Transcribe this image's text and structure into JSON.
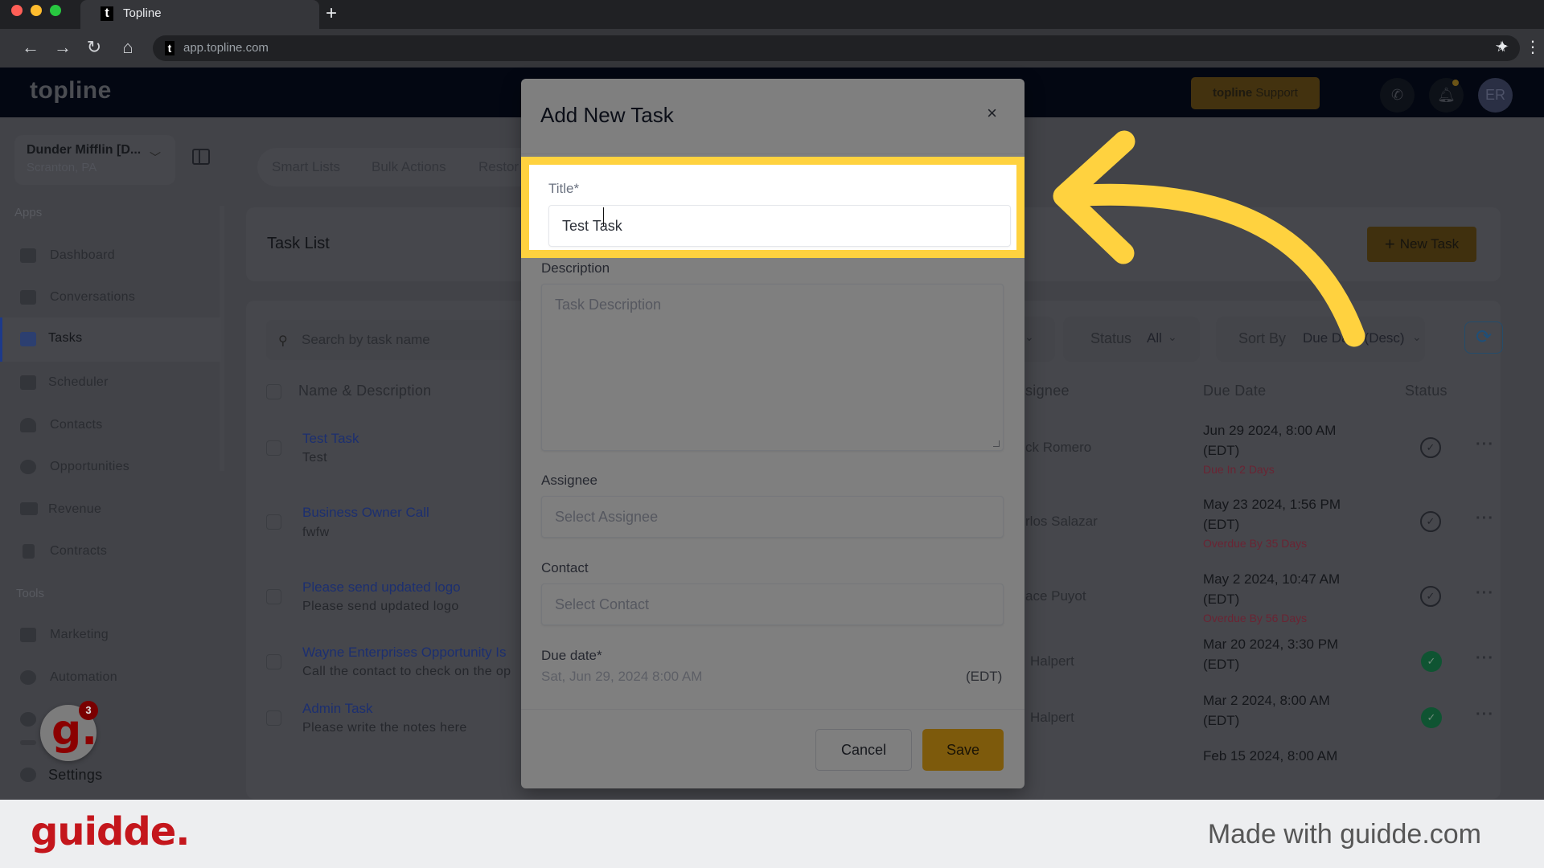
{
  "browser": {
    "tab_title": "Topline",
    "favicon_letter": "t",
    "new_tab_symbol": "+",
    "url": "app.topline.com",
    "icons": [
      "back-icon",
      "forward-icon",
      "reload-icon",
      "home-icon",
      "star-icon",
      "extensions-icon",
      "menu-icon"
    ]
  },
  "header": {
    "logo": "topline",
    "support_button_bold": "topline",
    "support_button_rest": "Support",
    "avatar_initials": "ER",
    "icons": [
      "phone-icon",
      "bell-icon"
    ]
  },
  "sidebar": {
    "location_name": "Dunder Mifflin [D...",
    "location_sub": "Scranton, PA",
    "sections": {
      "apps": "Apps",
      "tools": "Tools"
    },
    "apps_items": [
      {
        "label": "Dashboard",
        "icon": "dashboard-icon"
      },
      {
        "label": "Conversations",
        "icon": "chat-icon"
      },
      {
        "label": "Tasks",
        "icon": "task-icon",
        "active": true
      },
      {
        "label": "Scheduler",
        "icon": "calendar-icon"
      },
      {
        "label": "Contacts",
        "icon": "person-icon"
      },
      {
        "label": "Opportunities",
        "icon": "target-icon"
      },
      {
        "label": "Revenue",
        "icon": "card-icon"
      },
      {
        "label": "Contracts",
        "icon": "document-icon"
      }
    ],
    "tools_items": [
      {
        "label": "Marketing",
        "icon": "megaphone-icon"
      },
      {
        "label": "Automation",
        "icon": "gears-icon"
      },
      {
        "label": "",
        "icon": "globe-icon"
      },
      {
        "label": "",
        "icon": "dots-icon"
      },
      {
        "label": "Settings",
        "icon": "gear-icon"
      }
    ],
    "guidde_badge_count": "3",
    "guidde_letter": "g."
  },
  "main": {
    "tabs": [
      "Smart Lists",
      "Bulk Actions",
      "Restor"
    ],
    "task_list_title": "Task List",
    "new_task_button": "New Task",
    "search_placeholder": "Search by task name",
    "filters": {
      "status_label": "Status",
      "status_value": "All",
      "sort_label": "Sort By",
      "sort_value": "Due Date (Desc)"
    },
    "columns": [
      "Name & Description",
      "Assignee",
      "Due Date",
      "Status"
    ],
    "columns_visible": [
      "Name & Description",
      "signee",
      "Due Date",
      "Status"
    ],
    "rows": [
      {
        "title": "Test Task",
        "description": "Test",
        "assignee": "ck Romero",
        "due": "Jun 29 2024, 8:00 AM",
        "tz": "(EDT)",
        "note": "Due In 2 Days",
        "status": "open"
      },
      {
        "title": "Business Owner Call",
        "description": "fwfw",
        "assignee": "rlos Salazar",
        "due": "May 23 2024, 1:56 PM",
        "tz": "(EDT)",
        "note": "Overdue By 35 Days",
        "status": "open"
      },
      {
        "title": "Please send updated logo",
        "description": "Please send updated logo",
        "assignee": "ace Puyot",
        "due": "May 2 2024, 10:47 AM",
        "tz": "(EDT)",
        "note": "Overdue By 56 Days",
        "status": "open"
      },
      {
        "title": "Wayne Enterprises Opportunity Is",
        "description": "Call the contact to check on the op",
        "assignee": "Halpert",
        "due": "Mar 20 2024, 3:30 PM",
        "tz": "(EDT)",
        "note": "",
        "status": "done"
      },
      {
        "title": "Admin Task",
        "description": "Please write the notes here",
        "assignee": "Halpert",
        "due": "Mar 2 2024, 8:00 AM",
        "tz": "(EDT)",
        "note": "",
        "status": "done"
      },
      {
        "title": "",
        "description": "",
        "assignee": "",
        "due": "Feb 15 2024, 8:00 AM",
        "tz": "",
        "note": "",
        "status": ""
      }
    ]
  },
  "modal": {
    "title": "Add New Task",
    "close_symbol": "×",
    "title_label": "Title*",
    "title_value": "Test Task",
    "description_label": "Description",
    "description_placeholder": "Task Description",
    "assignee_label": "Assignee",
    "assignee_placeholder": "Select Assignee",
    "contact_label": "Contact",
    "contact_placeholder": "Select Contact",
    "due_label": "Due date*",
    "due_value": "Sat, Jun 29, 2024 8:00 AM",
    "due_tz": "(EDT)",
    "cancel_button": "Cancel",
    "save_button": "Save"
  },
  "annotation": {
    "highlight_color": "#ffd23f",
    "arrow_color": "#ffd23f"
  },
  "footer": {
    "logo": "guidde.",
    "tagline": "Made with guidde.com"
  },
  "colors": {
    "accent_yellow": "#ffd23f",
    "brand_red": "#c4161c",
    "save_button": "#7d5a0c",
    "overdue_text": "#6a2433",
    "done_status": "#0f5432"
  }
}
